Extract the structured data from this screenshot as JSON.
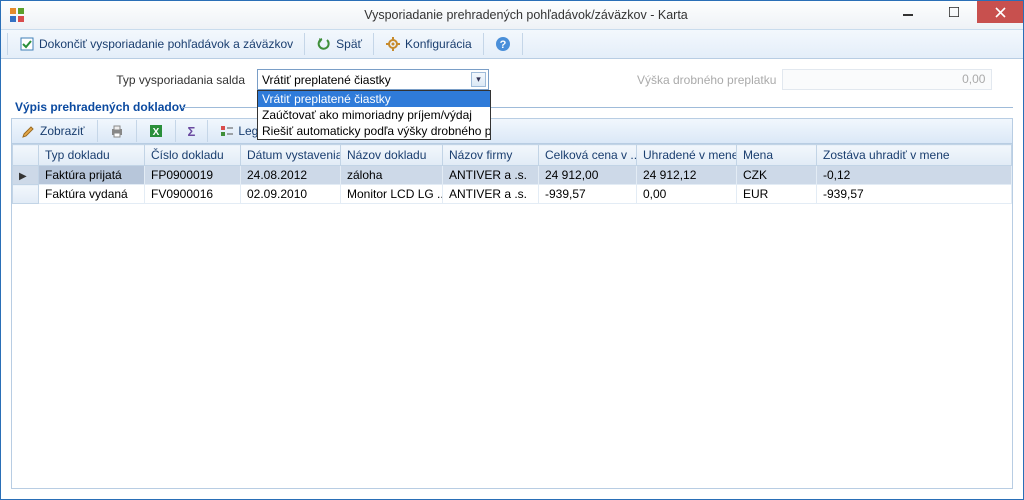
{
  "window": {
    "title": "Vysporiadanie prehradených pohľadávok/záväzkov - Karta"
  },
  "toolbar": {
    "finish_label": "Dokončiť vysporiadanie pohľadávok a záväzkov",
    "back_label": "Späť",
    "config_label": "Konfigurácia"
  },
  "form": {
    "type_label": "Typ vysporiadania salda",
    "type_value": "Vrátiť preplatené čiastky",
    "right_label": "Výška drobného preplatku",
    "right_value": "0,00",
    "options": [
      "Vrátiť preplatené čiastky",
      "Zaúčtovať ako mimoriadny príjem/výdaj",
      "Riešiť automaticky podľa výšky drobného preplatku"
    ]
  },
  "section": {
    "title": "Výpis prehradených dokladov"
  },
  "gridbar": {
    "show": "Zobraziť",
    "legend": "Legenda"
  },
  "grid": {
    "columns": [
      "Typ dokladu",
      "Číslo dokladu",
      "Dátum vystavenia",
      "Názov dokladu",
      "Názov firmy",
      "Celková cena v ...",
      "Uhradené v mene",
      "Mena",
      "Zostáva uhradiť v mene"
    ],
    "rows": [
      {
        "selected": true,
        "cells": [
          "Faktúra prijatá",
          "FP0900019",
          "24.08.2012",
          "záloha",
          "ANTIVER a .s.",
          "24 912,00",
          "24 912,12",
          "CZK",
          "-0,12"
        ]
      },
      {
        "selected": false,
        "cells": [
          "Faktúra vydaná",
          "FV0900016",
          "02.09.2010",
          "Monitor LCD LG ...",
          "ANTIVER a .s.",
          "-939,57",
          "0,00",
          "EUR",
          "-939,57"
        ]
      }
    ]
  }
}
